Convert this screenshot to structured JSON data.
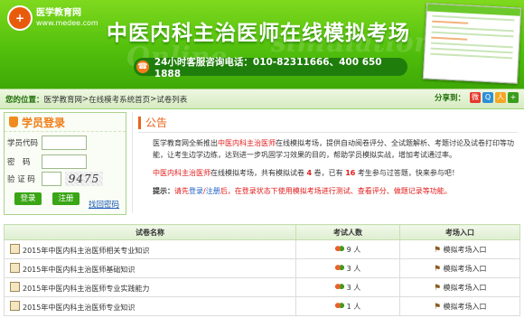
{
  "header": {
    "logo_cn": "医学教育网",
    "logo_en": "www.medee.com",
    "title": "中医内科主治医师在线模拟考场",
    "hotline": "24小时客服咨询电话：010-82311666、400 650 1888"
  },
  "nav": {
    "label": "您的位置：",
    "crumbs": [
      "医学教育网",
      "在线模考系统首页",
      "试卷列表"
    ],
    "sep": " > ",
    "share_label": "分享到："
  },
  "login": {
    "title": "学员登录",
    "username_label": "学员代码",
    "password_label": "密　码",
    "captcha_label": "验 证 码",
    "captcha_text": "9475",
    "login_button": "登录",
    "register_button": "注册",
    "forgot_link": "找回密码"
  },
  "notice": {
    "title": "公告",
    "p1_a": "医学教育网全新推出",
    "p1_red": "中医内科主治医师",
    "p1_b": "在线模拟考场，提供自动阅卷评分、全试题解析、考题讨论及试卷打印等功能，让考",
    "p1_c": "生边学边练，达到进一步巩固学习效果的目的，帮助学员模拟实战，增加考试通过率。",
    "p2_a": "中医内科主治医师",
    "p2_b": "在线模拟考场，共有模拟试卷",
    "p2_num1": "4",
    "p2_c": "卷，已有",
    "p2_num2": "16",
    "p2_d": "考生参与过答题，快来参与吧！",
    "tip_label": "提示：",
    "tip_a": "请先",
    "tip_login": "登录",
    "tip_slash": "/",
    "tip_register": "注册",
    "tip_b": "后，在登录状态下使用模拟考场进行测试、查看评分、做题记录等功能。"
  },
  "table": {
    "headers": [
      "试卷名称",
      "考试人数",
      "考场入口"
    ],
    "entry_label": "模拟考场入口",
    "rows": [
      {
        "name": "2015年中医内科主治医师相关专业知识",
        "count": "9 人"
      },
      {
        "name": "2015年中医内科主治医师基础知识",
        "count": "3 人"
      },
      {
        "name": "2015年中医内科主治医师专业实践能力",
        "count": "3 人"
      },
      {
        "name": "2015年中医内科主治医师专业知识",
        "count": "1 人"
      }
    ]
  },
  "colors": {
    "banner_green": "#52c00c",
    "accent_orange": "#e8641c",
    "link_blue": "#1a5fc4",
    "alert_red": "#e31b1b"
  }
}
